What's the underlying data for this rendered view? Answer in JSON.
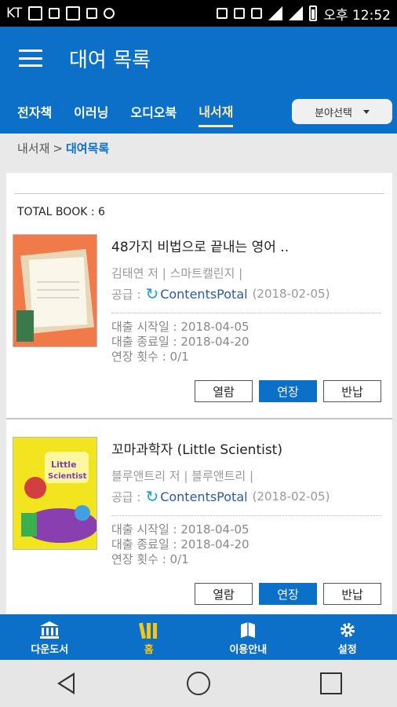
{
  "status_bar": {
    "carrier": "KT",
    "time": "오후 12:52"
  },
  "app_bar": {
    "title": "대여 목록"
  },
  "tabs": [
    {
      "label": "전자책",
      "active": false
    },
    {
      "label": "이러닝",
      "active": false
    },
    {
      "label": "오디오북",
      "active": false
    },
    {
      "label": "내서재",
      "active": true
    }
  ],
  "field_select": {
    "label": "분야선택"
  },
  "breadcrumb": {
    "parent": "내서재",
    "separator": ">",
    "current": "대여목록"
  },
  "total_books": "TOTAL BOOK : 6",
  "books": [
    {
      "title": "48가지 비법으로 끝내는 영어 ..",
      "author": "김태연 저",
      "publisher": "스마트캘린지",
      "supply_label": "공급 :",
      "supplier": "ContentsPotal",
      "supply_date": "(2018-02-05)",
      "loan_start": "대출 시작일 : 2018-04-05",
      "loan_end": "대출 종료일 : 2018-04-20",
      "renewals": "연장 횟수 : 0/1",
      "btn_view": "열람",
      "btn_extend": "연장",
      "btn_return": "반납",
      "cover_colors": [
        "#f07a4a",
        "#e8d8b8"
      ]
    },
    {
      "title": "꼬마과학자 (Little Scientist)",
      "author": "블루앤트리 저",
      "publisher": "블루앤트리",
      "supply_label": "공급 :",
      "supplier": "ContentsPotal",
      "supply_date": "(2018-02-05)",
      "loan_start": "대출 시작일 : 2018-04-05",
      "loan_end": "대출 종료일 : 2018-04-20",
      "renewals": "연장 횟수 : 0/1",
      "btn_view": "열람",
      "btn_extend": "연장",
      "btn_return": "반납",
      "cover_colors": [
        "#f2e41e",
        "#8a3fb0"
      ]
    }
  ],
  "bottom_nav": [
    {
      "label": "다운도서",
      "icon": "library-icon",
      "active": false
    },
    {
      "label": "홈",
      "icon": "books-icon",
      "active": true
    },
    {
      "label": "이용안내",
      "icon": "book-guide-icon",
      "active": false
    },
    {
      "label": "설정",
      "icon": "gear-icon",
      "active": false
    }
  ],
  "colors": {
    "primary": "#0c70c9",
    "active_nav": "#f5c518",
    "active_tab": "#f7e7a8"
  }
}
